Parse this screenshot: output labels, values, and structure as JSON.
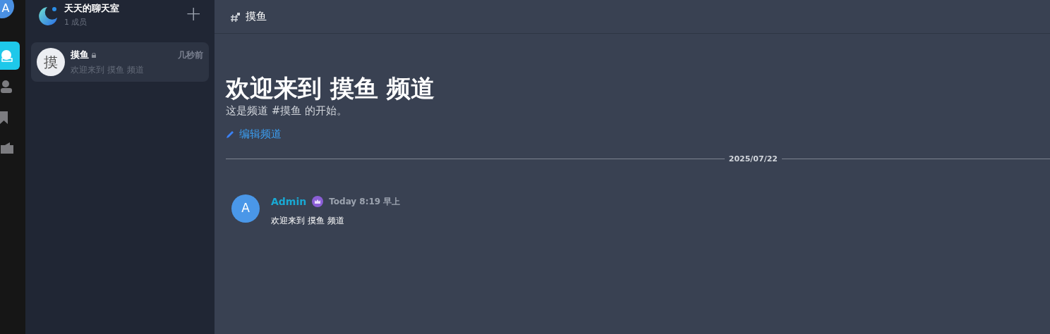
{
  "user_avatar": {
    "initial": "A"
  },
  "rail": [
    {
      "kind": "chat",
      "selected": true
    },
    {
      "kind": "person",
      "selected": false
    },
    {
      "kind": "bookmark",
      "selected": false
    },
    {
      "kind": "folder",
      "selected": false
    }
  ],
  "group": {
    "name": "天天的聊天室",
    "members": "1 成员",
    "add": "+"
  },
  "channels": [
    {
      "avatar": "摸",
      "name": "摸鱼",
      "locked": true,
      "time": "几秒前",
      "preview": "欢迎来到 摸鱼 频道",
      "selected": true
    }
  ],
  "header": {
    "channel": "摸鱼"
  },
  "welcome": {
    "title": "欢迎来到 摸鱼 频道",
    "subtitle": "这是频道 #摸鱼 的开始。",
    "edit": "编辑频道"
  },
  "date_divider": "2025/07/22",
  "messages": [
    {
      "initial": "A",
      "author": "Admin",
      "admin": true,
      "time": "Today 8:19 早上",
      "text": "欢迎来到 摸鱼 频道"
    }
  ]
}
